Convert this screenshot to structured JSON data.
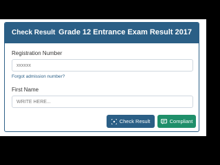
{
  "header": {
    "left_title": "Check Result",
    "right_title": "Grade 12 Entrance Exam Result 2017"
  },
  "form": {
    "registration": {
      "label": "Registration Number",
      "placeholder": "xxxxxx"
    },
    "forgot_link": "Forgot admission number?",
    "first_name": {
      "label": "First Name",
      "placeholder": "WRITE HERE..."
    }
  },
  "buttons": {
    "check_result": "Check Result",
    "compliant": "Compliant"
  },
  "colors": {
    "header_blue": "#2b5f86",
    "compliant_green": "#1f8f6a"
  }
}
